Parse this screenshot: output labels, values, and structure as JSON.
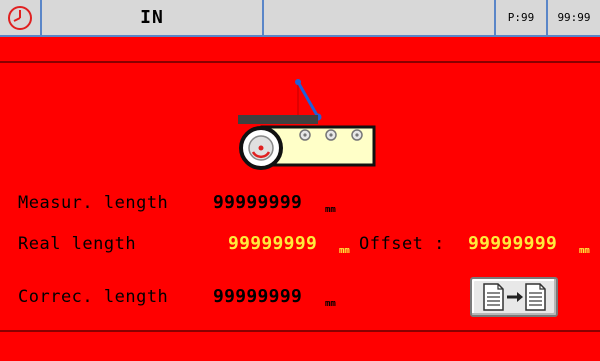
{
  "status": {
    "mode_label": "IN",
    "program_label": "P:99",
    "counter_label": "99:99"
  },
  "icons": {
    "clock": "clock-icon",
    "conveyor": "conveyor-encoder-icon",
    "copy": "copy-document-icon"
  },
  "fields": {
    "measured": {
      "label": "Measur. length",
      "value": "99999999",
      "unit": "mm"
    },
    "real": {
      "label": "Real length",
      "value": "99999999",
      "unit": "mm"
    },
    "offset": {
      "label": "Offset :",
      "value": "99999999",
      "unit": "mm"
    },
    "corrected": {
      "label": "Correc. length",
      "value": "99999999",
      "unit": "mm"
    }
  },
  "colors": {
    "background": "#ff0000",
    "status_bar": "#d8d8d8",
    "editable_value": "#ffeb3b",
    "accent_blue": "#5a86c8"
  }
}
